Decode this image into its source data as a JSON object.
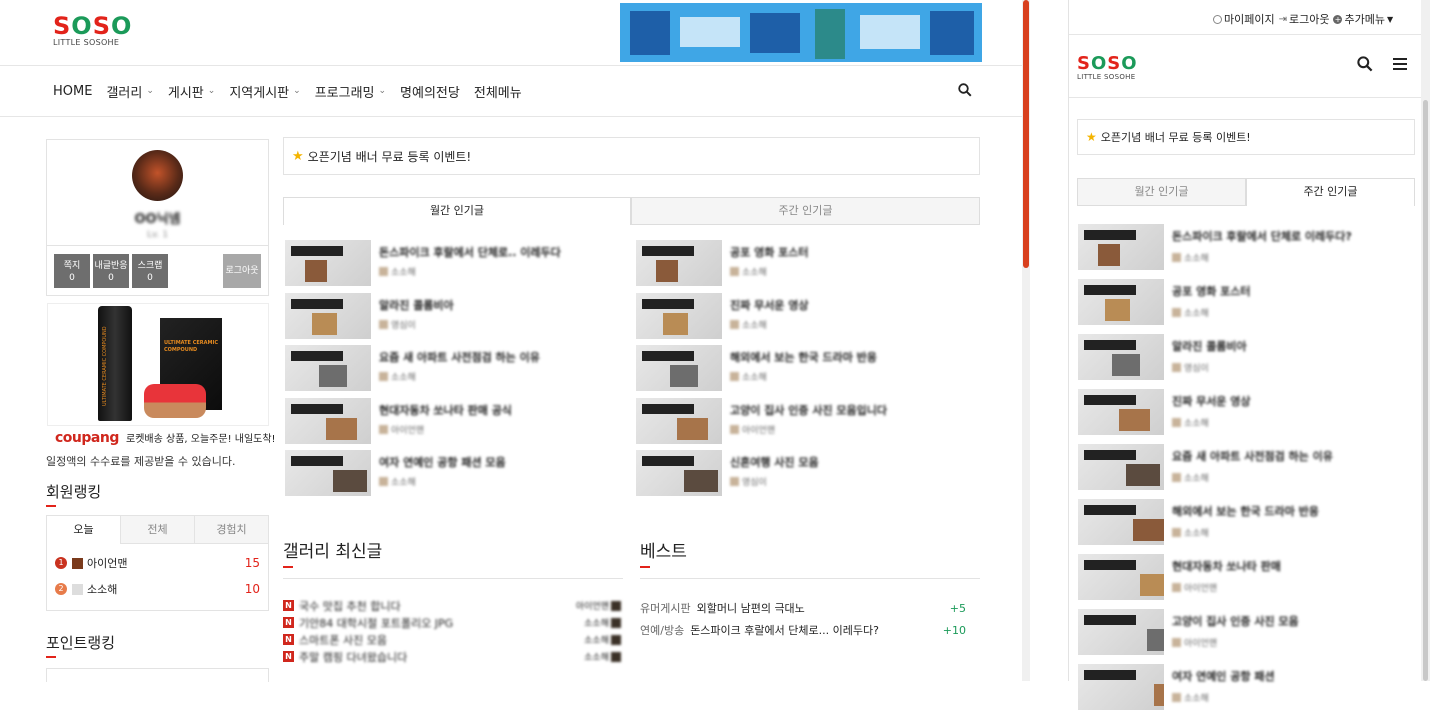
{
  "left": {
    "logo": {
      "letters": [
        "S",
        "O",
        "S",
        "O"
      ],
      "subtitle": "LITTLE SOSOHE"
    },
    "nav": [
      {
        "label": "HOME",
        "has_dropdown": false
      },
      {
        "label": "갤러리",
        "has_dropdown": true
      },
      {
        "label": "게시판",
        "has_dropdown": true
      },
      {
        "label": "지역게시판",
        "has_dropdown": true
      },
      {
        "label": "프로그래밍",
        "has_dropdown": true
      },
      {
        "label": "명예의전당",
        "has_dropdown": false
      },
      {
        "label": "전체메뉴",
        "has_dropdown": false
      }
    ],
    "profile": {
      "name": "OO닉넴",
      "level": "Lv. 1",
      "stats": [
        {
          "label": "쪽지",
          "value": "0"
        },
        {
          "label": "내글반응",
          "value": "0"
        },
        {
          "label": "스크랩",
          "value": "0"
        }
      ],
      "logout": "로그아웃"
    },
    "ad": {
      "bottle_text": "ULTIMATE CERAMIC COMPOUND",
      "box_text": "ULTIMATE CERAMIC COMPOUND",
      "brand": "coupang",
      "tagline": "로켓배송 상품, 오늘주문! 내일도착!",
      "disclaimer": "일정액의 수수료를 제공받을 수 있습니다."
    },
    "member_ranking": {
      "title": "회원랭킹",
      "tabs": [
        "오늘",
        "전체",
        "경험치"
      ],
      "active_tab": 0,
      "rows": [
        {
          "rank": "1",
          "name": "아이언맨",
          "score": "15"
        },
        {
          "rank": "2",
          "name": "소소해",
          "score": "10"
        }
      ]
    },
    "point_ranking": {
      "title": "포인트랭킹"
    },
    "banner": {
      "text": "오픈기념 배너 무료 등록 이벤트!"
    },
    "popular_tabs": [
      "월간 인기글",
      "주간 인기글"
    ],
    "popular_active": 0,
    "popular_left": [
      {
        "title": "돈스파이크 후랄에서 단체로.. 이레두다",
        "author": "소소해"
      },
      {
        "title": "알라진 콜롬비아",
        "author": "영심이"
      },
      {
        "title": "요즘 새 아파트 사전점검 하는 이유",
        "author": "소소해"
      },
      {
        "title": "현대자동차 쏘나타 판매 공식",
        "author": "아이언맨"
      },
      {
        "title": "여자 연예인 공항 패션 모음",
        "author": "소소해"
      }
    ],
    "popular_right": [
      {
        "title": "공포 영화 포스터",
        "author": "소소해"
      },
      {
        "title": "진짜 무서운 영상",
        "author": "소소해"
      },
      {
        "title": "해외에서 보는 한국 드라마 반응",
        "author": "소소해"
      },
      {
        "title": "고양이 집사 인증 사진 모음입니다",
        "author": "아이언맨"
      },
      {
        "title": "신혼여행 사진 모음",
        "author": "영심이"
      }
    ],
    "gallery": {
      "title": "갤러리 최신글",
      "items": [
        {
          "title": "국수 맛집 추천 합니다",
          "author": "아이언맨"
        },
        {
          "title": "기안84 대학시절 포트폴리오 JPG",
          "author": "소소해"
        },
        {
          "title": "스마트폰 사진 모음",
          "author": "소소해"
        },
        {
          "title": "주말 캠핑 다녀왔습니다",
          "author": "소소해"
        }
      ]
    },
    "best": {
      "title": "베스트",
      "items": [
        {
          "category": "유머게시판",
          "title": "외할머니 남편의 극대노",
          "score": "+5"
        },
        {
          "category": "연예/방송",
          "title": "돈스파이크 후랄에서 단체로... 이레두다?",
          "score": "+10"
        }
      ]
    }
  },
  "right": {
    "topbar": {
      "mypage": "마이페이지",
      "logout": "로그아웃",
      "more": "추가메뉴"
    },
    "logo": {
      "letters": [
        "S",
        "O",
        "S",
        "O"
      ],
      "subtitle": "LITTLE SOSOHE"
    },
    "banner": {
      "text": "오픈기념 배너 무료 등록 이벤트!"
    },
    "tabs": [
      "월간 인기글",
      "주간 인기글"
    ],
    "active_tab": 1,
    "list": [
      {
        "title": "돈스파이크 후랄에서 단체로 이레두다?",
        "author": "소소해"
      },
      {
        "title": "공포 영화 포스터",
        "author": "소소해"
      },
      {
        "title": "알라진 콜롬비아",
        "author": "영심이"
      },
      {
        "title": "진짜 무서운 영상",
        "author": "소소해"
      },
      {
        "title": "요즘 새 아파트 사전점검 하는 이유",
        "author": "소소해"
      },
      {
        "title": "해외에서 보는 한국 드라마 반응",
        "author": "소소해"
      },
      {
        "title": "현대자동차 쏘나타 판매",
        "author": "아이언맨"
      },
      {
        "title": "고양이 집사 인증 사진 모음",
        "author": "아이언맨"
      },
      {
        "title": "여자 연예인 공항 패션",
        "author": "소소해"
      }
    ]
  },
  "colors": {
    "accent_red": "#e2231a",
    "logo_green": "#1b9a59",
    "score_green": "#1b9a59"
  }
}
